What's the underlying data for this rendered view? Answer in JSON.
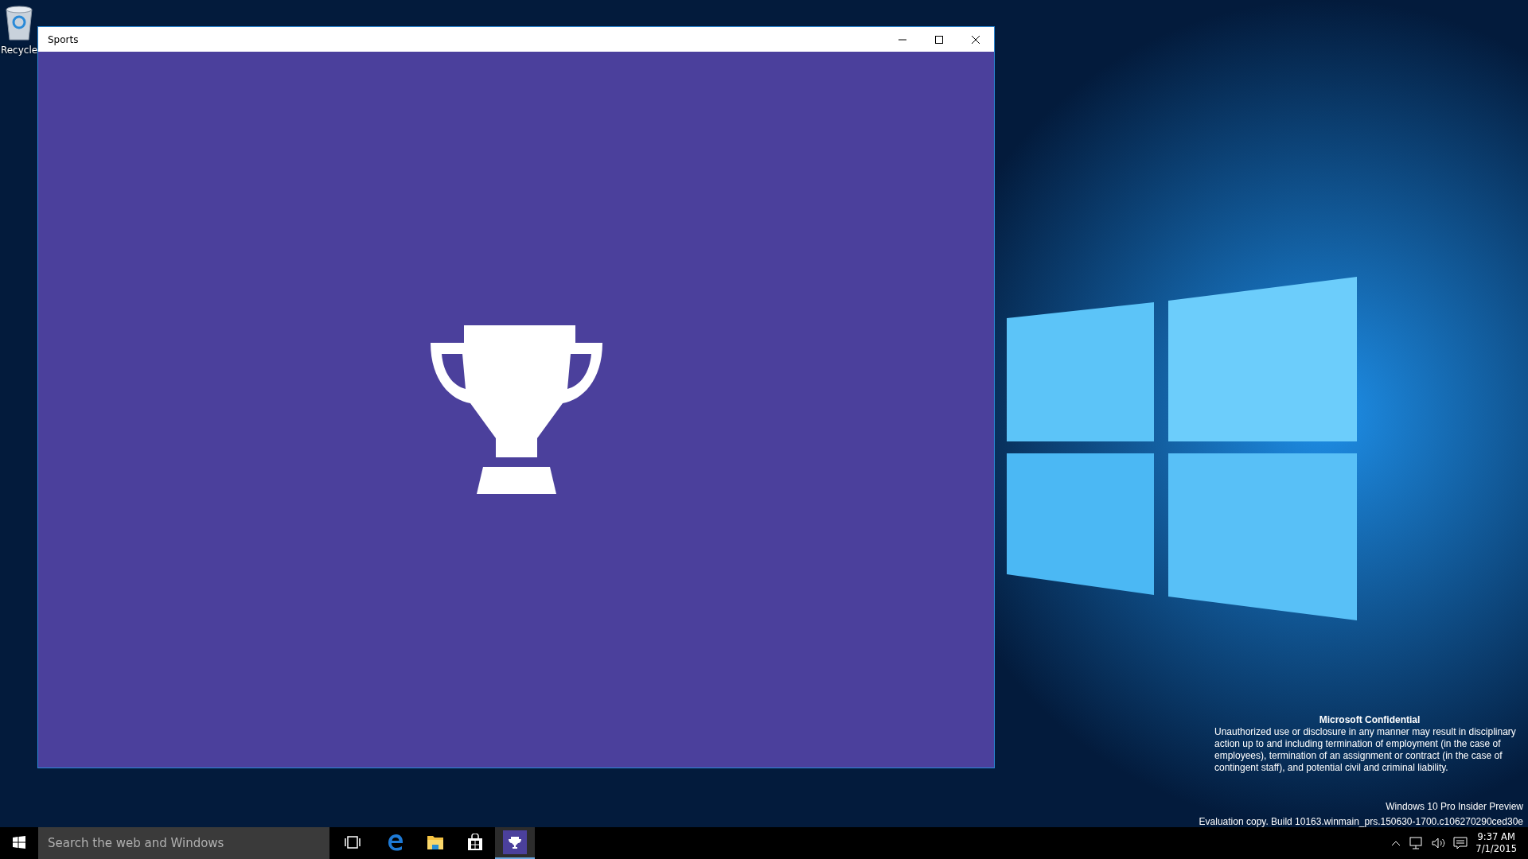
{
  "desktop_icons": [
    {
      "label": "Recycle"
    }
  ],
  "window": {
    "title": "Sports",
    "active": true
  },
  "notice": {
    "heading": "Microsoft Confidential",
    "body": "Unauthorized use or disclosure in any manner may result in disciplinary action up to and including termination of employment (in the case of employees), termination of an assignment or contract (in the case of contingent staff), and potential civil and criminal liability."
  },
  "build_info": {
    "edition": "Windows 10 Pro Insider Preview",
    "build": "Evaluation copy. Build 10163.winmain_prs.150630-1700.c106270290ced30e"
  },
  "taskbar": {
    "search": {
      "placeholder": "Search the web and Windows"
    },
    "apps": [
      {
        "kind": "taskview",
        "selected": false
      },
      {
        "kind": "edge",
        "selected": false
      },
      {
        "kind": "explorer",
        "selected": false
      },
      {
        "kind": "store",
        "selected": false
      },
      {
        "kind": "sports",
        "selected": true
      }
    ],
    "clock": {
      "time": "9:37 AM",
      "date": "7/1/2015"
    }
  }
}
